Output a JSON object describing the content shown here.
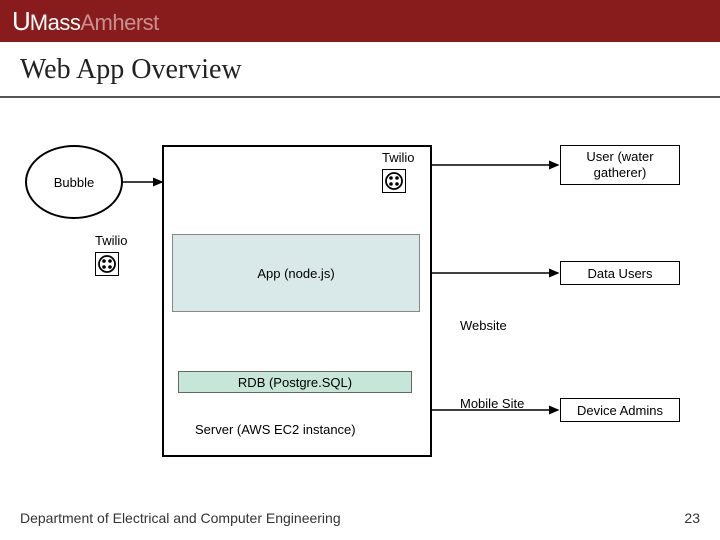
{
  "header": {
    "logo_u": "U",
    "logo_mass": "Mass",
    "logo_amherst": "Amherst"
  },
  "title": "Web App Overview",
  "diagram": {
    "bubble": "Bubble",
    "twilio_top": "Twilio",
    "twilio_left": "Twilio",
    "app": "App (node.js)",
    "rdb": "RDB (Postgre.SQL)",
    "server": "Server (AWS EC2 instance)",
    "user": "User (water gatherer)",
    "data_users": "Data Users",
    "device_admins": "Device Admins",
    "website": "Website",
    "mobile": "Mobile Site"
  },
  "footer": {
    "dept": "Department of Electrical and Computer Engineering",
    "page": "23"
  }
}
